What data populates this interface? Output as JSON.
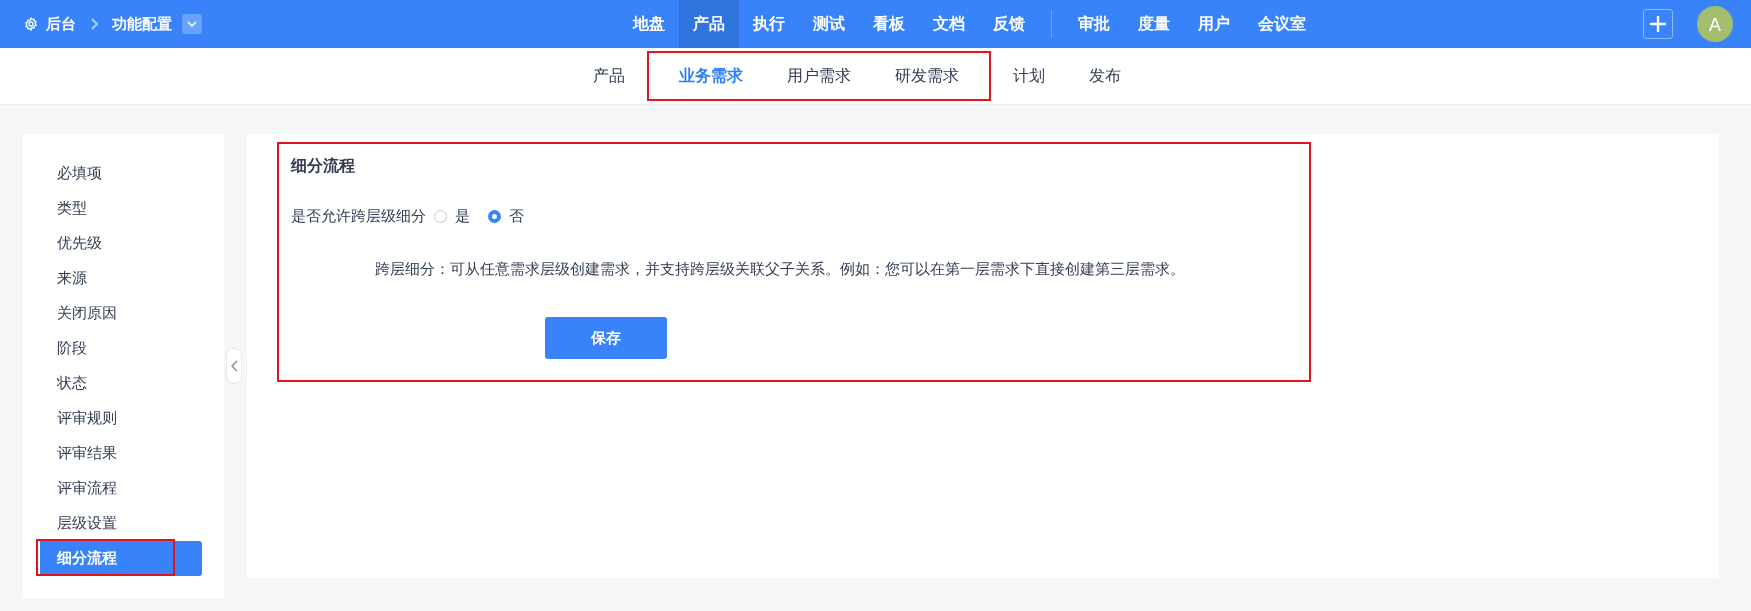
{
  "top_bar": {
    "breadcrumb": [
      {
        "label": "后台"
      },
      {
        "label": "功能配置"
      }
    ],
    "nav_groups": [
      [
        {
          "label": "地盘",
          "selected": false
        },
        {
          "label": "产品",
          "selected": true
        },
        {
          "label": "执行",
          "selected": false
        },
        {
          "label": "测试",
          "selected": false
        },
        {
          "label": "看板",
          "selected": false
        },
        {
          "label": "文档",
          "selected": false
        },
        {
          "label": "反馈",
          "selected": false
        }
      ],
      [
        {
          "label": "审批",
          "selected": false
        },
        {
          "label": "度量",
          "selected": false
        },
        {
          "label": "用户",
          "selected": false
        },
        {
          "label": "会议室",
          "selected": false
        }
      ]
    ],
    "avatar": "A"
  },
  "sub_nav": [
    {
      "label": "产品",
      "selected": false,
      "highlighted": false
    },
    {
      "label": "业务需求",
      "selected": true,
      "highlighted": true
    },
    {
      "label": "用户需求",
      "selected": false,
      "highlighted": true
    },
    {
      "label": "研发需求",
      "selected": false,
      "highlighted": true
    },
    {
      "label": "计划",
      "selected": false,
      "highlighted": false
    },
    {
      "label": "发布",
      "selected": false,
      "highlighted": false
    }
  ],
  "sidebar": {
    "items": [
      {
        "label": "必填项",
        "selected": false,
        "highlighted": false
      },
      {
        "label": "类型",
        "selected": false,
        "highlighted": false
      },
      {
        "label": "优先级",
        "selected": false,
        "highlighted": false
      },
      {
        "label": "来源",
        "selected": false,
        "highlighted": false
      },
      {
        "label": "关闭原因",
        "selected": false,
        "highlighted": false
      },
      {
        "label": "阶段",
        "selected": false,
        "highlighted": false
      },
      {
        "label": "状态",
        "selected": false,
        "highlighted": false
      },
      {
        "label": "评审规则",
        "selected": false,
        "highlighted": false
      },
      {
        "label": "评审结果",
        "selected": false,
        "highlighted": false
      },
      {
        "label": "评审流程",
        "selected": false,
        "highlighted": false
      },
      {
        "label": "层级设置",
        "selected": false,
        "highlighted": false
      },
      {
        "label": "细分流程",
        "selected": true,
        "highlighted": true
      }
    ]
  },
  "section": {
    "title": "细分流程",
    "highlighted": true,
    "field": {
      "label": "是否允许跨层级细分",
      "options": [
        {
          "label": "是",
          "selected": false
        },
        {
          "label": "否",
          "selected": true
        }
      ]
    },
    "description": "跨层细分：可从任意需求层级创建需求，并支持跨层级关联父子关系。例如：您可以在第一层需求下直接创建第三层需求。",
    "save_button": "保存"
  }
}
